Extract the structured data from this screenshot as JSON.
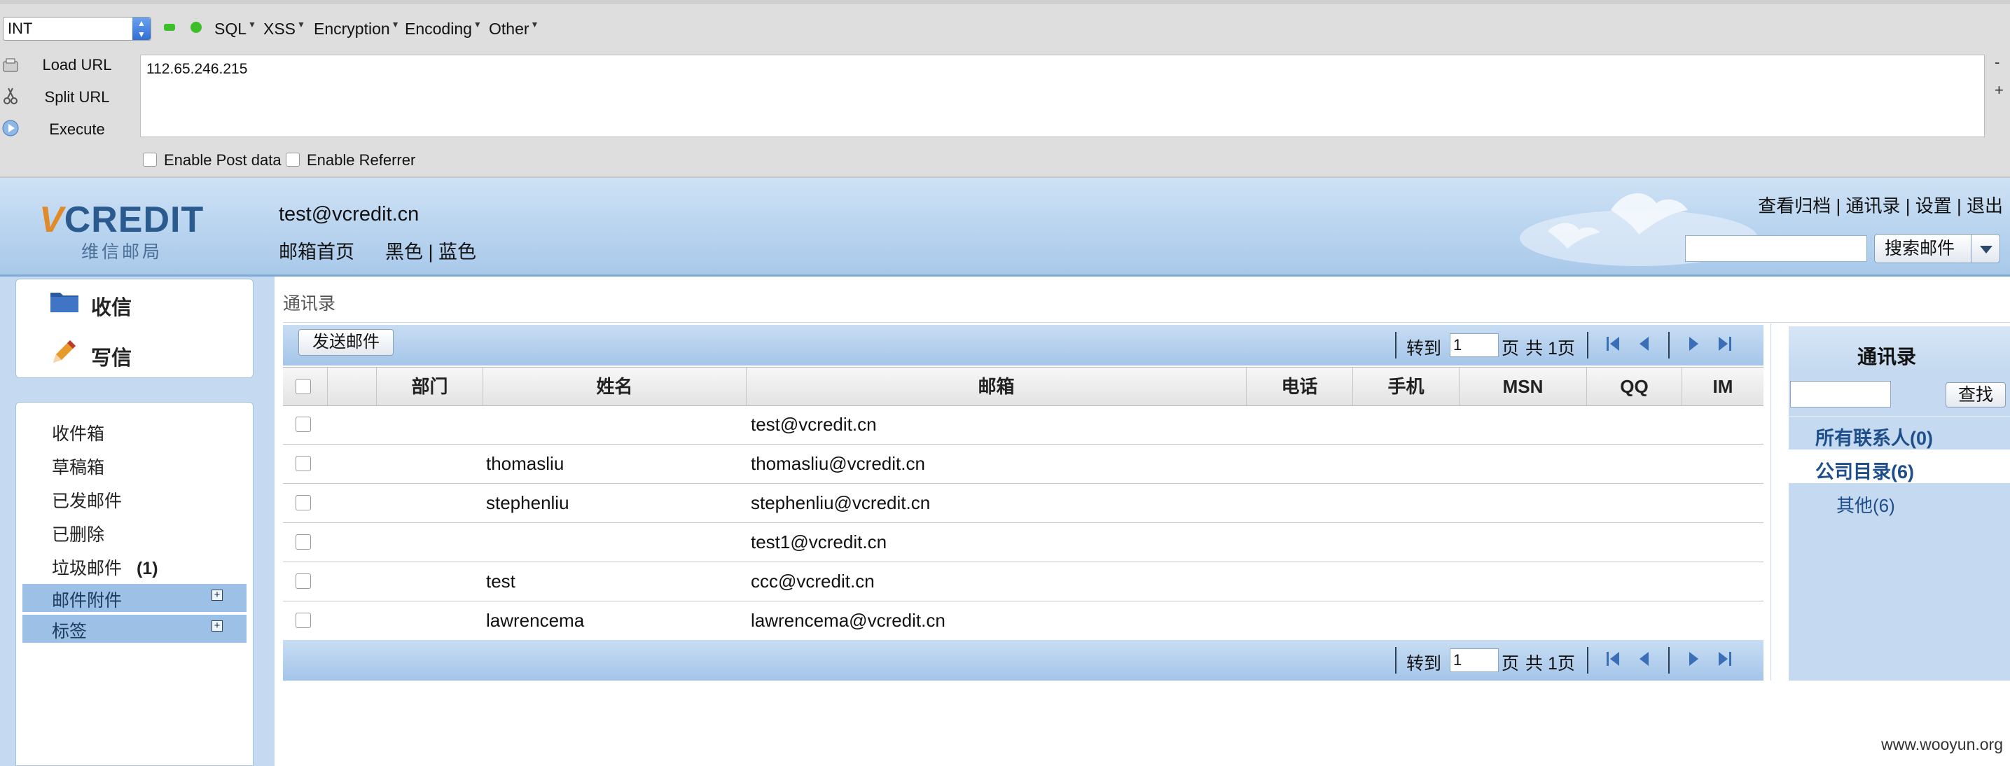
{
  "hackbar": {
    "select_value": "INT",
    "menus": [
      "SQL",
      "XSS",
      "Encryption",
      "Encoding",
      "Other"
    ],
    "side_buttons": [
      "Load URL",
      "Split URL",
      "Execute"
    ],
    "url_value": "112.65.246.215",
    "checkboxes": [
      "Enable Post data",
      "Enable Referrer"
    ],
    "zoom_minus": "-",
    "zoom_plus": "+"
  },
  "header": {
    "brand_v": "V",
    "brand_rest": "CREDIT",
    "brand_sub": "维信邮局",
    "user_email": "test@vcredit.cn",
    "home_link": "邮箱首页",
    "skin_black": "黑色",
    "skin_sep": "|",
    "skin_blue": "蓝色",
    "top_links": [
      "查看归档",
      "通讯录",
      "设置",
      "退出"
    ],
    "search_button": "搜索邮件"
  },
  "sidebar": {
    "inbox_button": "收信",
    "compose_button": "写信",
    "folders": [
      "收件箱",
      "草稿箱",
      "已发邮件",
      "已删除",
      "垃圾邮件"
    ],
    "spam_count": "(1)",
    "attachments": "邮件附件",
    "tags": "标签"
  },
  "main": {
    "breadcrumb": "通讯录",
    "send_button": "发送邮件",
    "pager": {
      "goto": "转到",
      "page_value": "1",
      "page_unit": "页",
      "total": "共 1页"
    },
    "columns": [
      "部门",
      "姓名",
      "邮箱",
      "电话",
      "手机",
      "MSN",
      "QQ",
      "IM"
    ],
    "rows": [
      {
        "dept": "",
        "name": "",
        "email": "test@vcredit.cn"
      },
      {
        "dept": "",
        "name": "thomasliu",
        "email": "thomasliu@vcredit.cn"
      },
      {
        "dept": "",
        "name": "stephenliu",
        "email": "stephenliu@vcredit.cn"
      },
      {
        "dept": "",
        "name": "",
        "email": "test1@vcredit.cn"
      },
      {
        "dept": "",
        "name": "test",
        "email": "ccc@vcredit.cn"
      },
      {
        "dept": "",
        "name": "lawrencema",
        "email": "lawrencema@vcredit.cn"
      }
    ]
  },
  "contacts_panel": {
    "title": "通讯录",
    "search_button": "查找",
    "all_contacts": "所有联系人(0)",
    "company_dir": "公司目录(6)",
    "other": "其他(6)"
  },
  "watermark": "www.wooyun.org",
  "colors": {
    "header_blue": "#bcd6f0",
    "sidebar_blue": "#c5daf0",
    "link_blue": "#1f4f8a",
    "hackbar_gray": "#dedede"
  }
}
